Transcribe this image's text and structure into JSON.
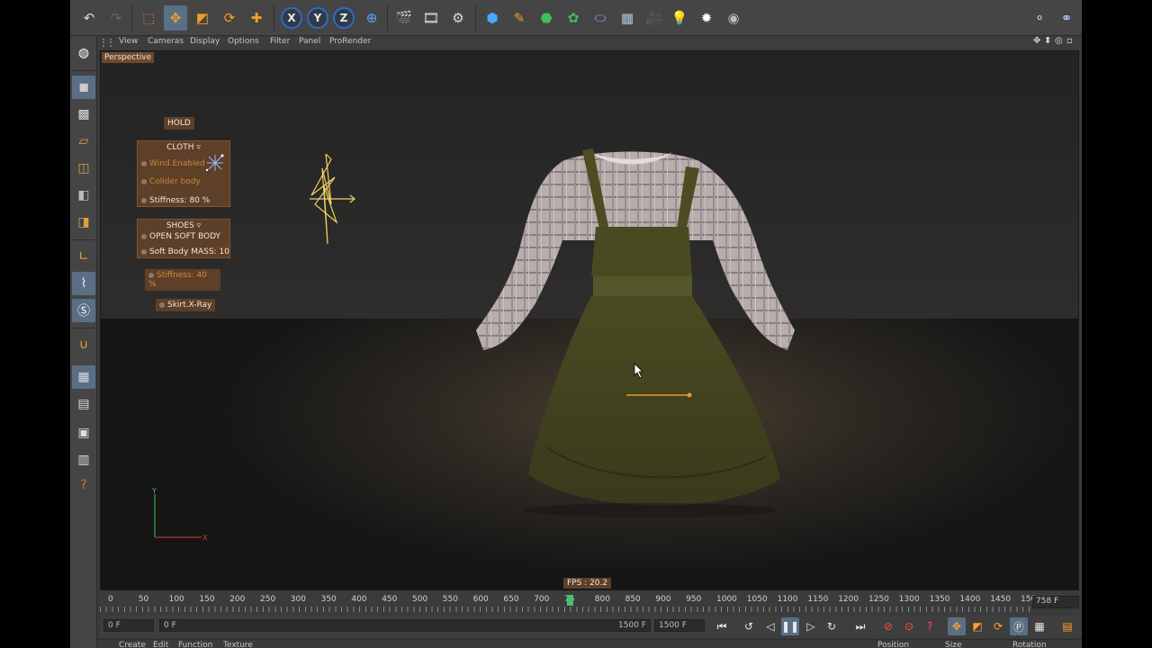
{
  "viewport_menu": [
    "View",
    "Cameras",
    "Display",
    "Options",
    "Filter",
    "Panel",
    "ProRender"
  ],
  "camera_label": "Perspective",
  "hud": {
    "hold": "HOLD",
    "cloth_title": "CLOTH",
    "cloth_wind": "Wind.Enabled",
    "cloth_collider": "Colider body",
    "cloth_stiffness": "Stiffness:  80 %",
    "shoes_title": "SHOES",
    "shoes_open": "OPEN SOFT BODY",
    "shoes_mass": "Soft Body MASS:  10",
    "stiffness2": "Stiffness:  40 %",
    "skirt_xray": "Skirt.X-Ray"
  },
  "axis_labels": {
    "y": "Y",
    "x": "X"
  },
  "fps": "FPS : 20.2",
  "timeline": {
    "ticks": [
      "0",
      "50",
      "100",
      "150",
      "200",
      "250",
      "300",
      "350",
      "400",
      "450",
      "500",
      "550",
      "600",
      "650",
      "700",
      "75",
      "800",
      "850",
      "900",
      "950",
      "1000",
      "1050",
      "1100",
      "1150",
      "1200",
      "1250",
      "1300",
      "1350",
      "1400",
      "1450",
      "150"
    ],
    "current_frame": "758 F",
    "current_value": 758,
    "max_value": 1500
  },
  "transport": {
    "start_field": "0 F",
    "range_start": "0 F",
    "range_end": "1500 F",
    "end_field": "1500 F"
  },
  "bottom_menu": [
    "Create",
    "Edit",
    "Function",
    "Texture"
  ],
  "attr_headers": [
    "Position",
    "Size",
    "Rotation"
  ],
  "icons": {
    "top_toolbar": [
      "undo-icon",
      "redo-icon",
      "live-select-icon",
      "move-icon",
      "scale-icon",
      "rotate-icon",
      "add-icon",
      "x-axis-icon",
      "y-axis-icon",
      "z-axis-icon",
      "world-coords-icon",
      "render-view-icon",
      "render-picture-viewer-icon",
      "render-settings-icon",
      "cube-icon",
      "pen-icon",
      "subdivision-icon",
      "array-icon",
      "deformer-icon",
      "floor-icon",
      "camera-icon",
      "light-icon",
      "sky-icon",
      "prorender-icon",
      "layout-icon-1",
      "layout-icon-2"
    ],
    "left_palette": [
      "make-editable-icon",
      "model-mode-icon",
      "texture-mode-icon",
      "workplane-icon",
      "points-mode-icon",
      "edges-mode-icon",
      "polygons-mode-icon",
      "axis-mode-icon",
      "tweak-mode-icon",
      "solo-mode-icon",
      "magnet-icon",
      "snap-icon",
      "enable-axis-icon",
      "script-icon",
      "script2-icon",
      "help-icon"
    ]
  },
  "colors": {
    "accent_blue": "#5a6f86",
    "hud_brown": "#5e3f28",
    "playhead_green": "#3ec46a",
    "axis_green": "#3fc75a",
    "axis_red": "#d04040",
    "gizmo_yellow": "#f0d060"
  }
}
